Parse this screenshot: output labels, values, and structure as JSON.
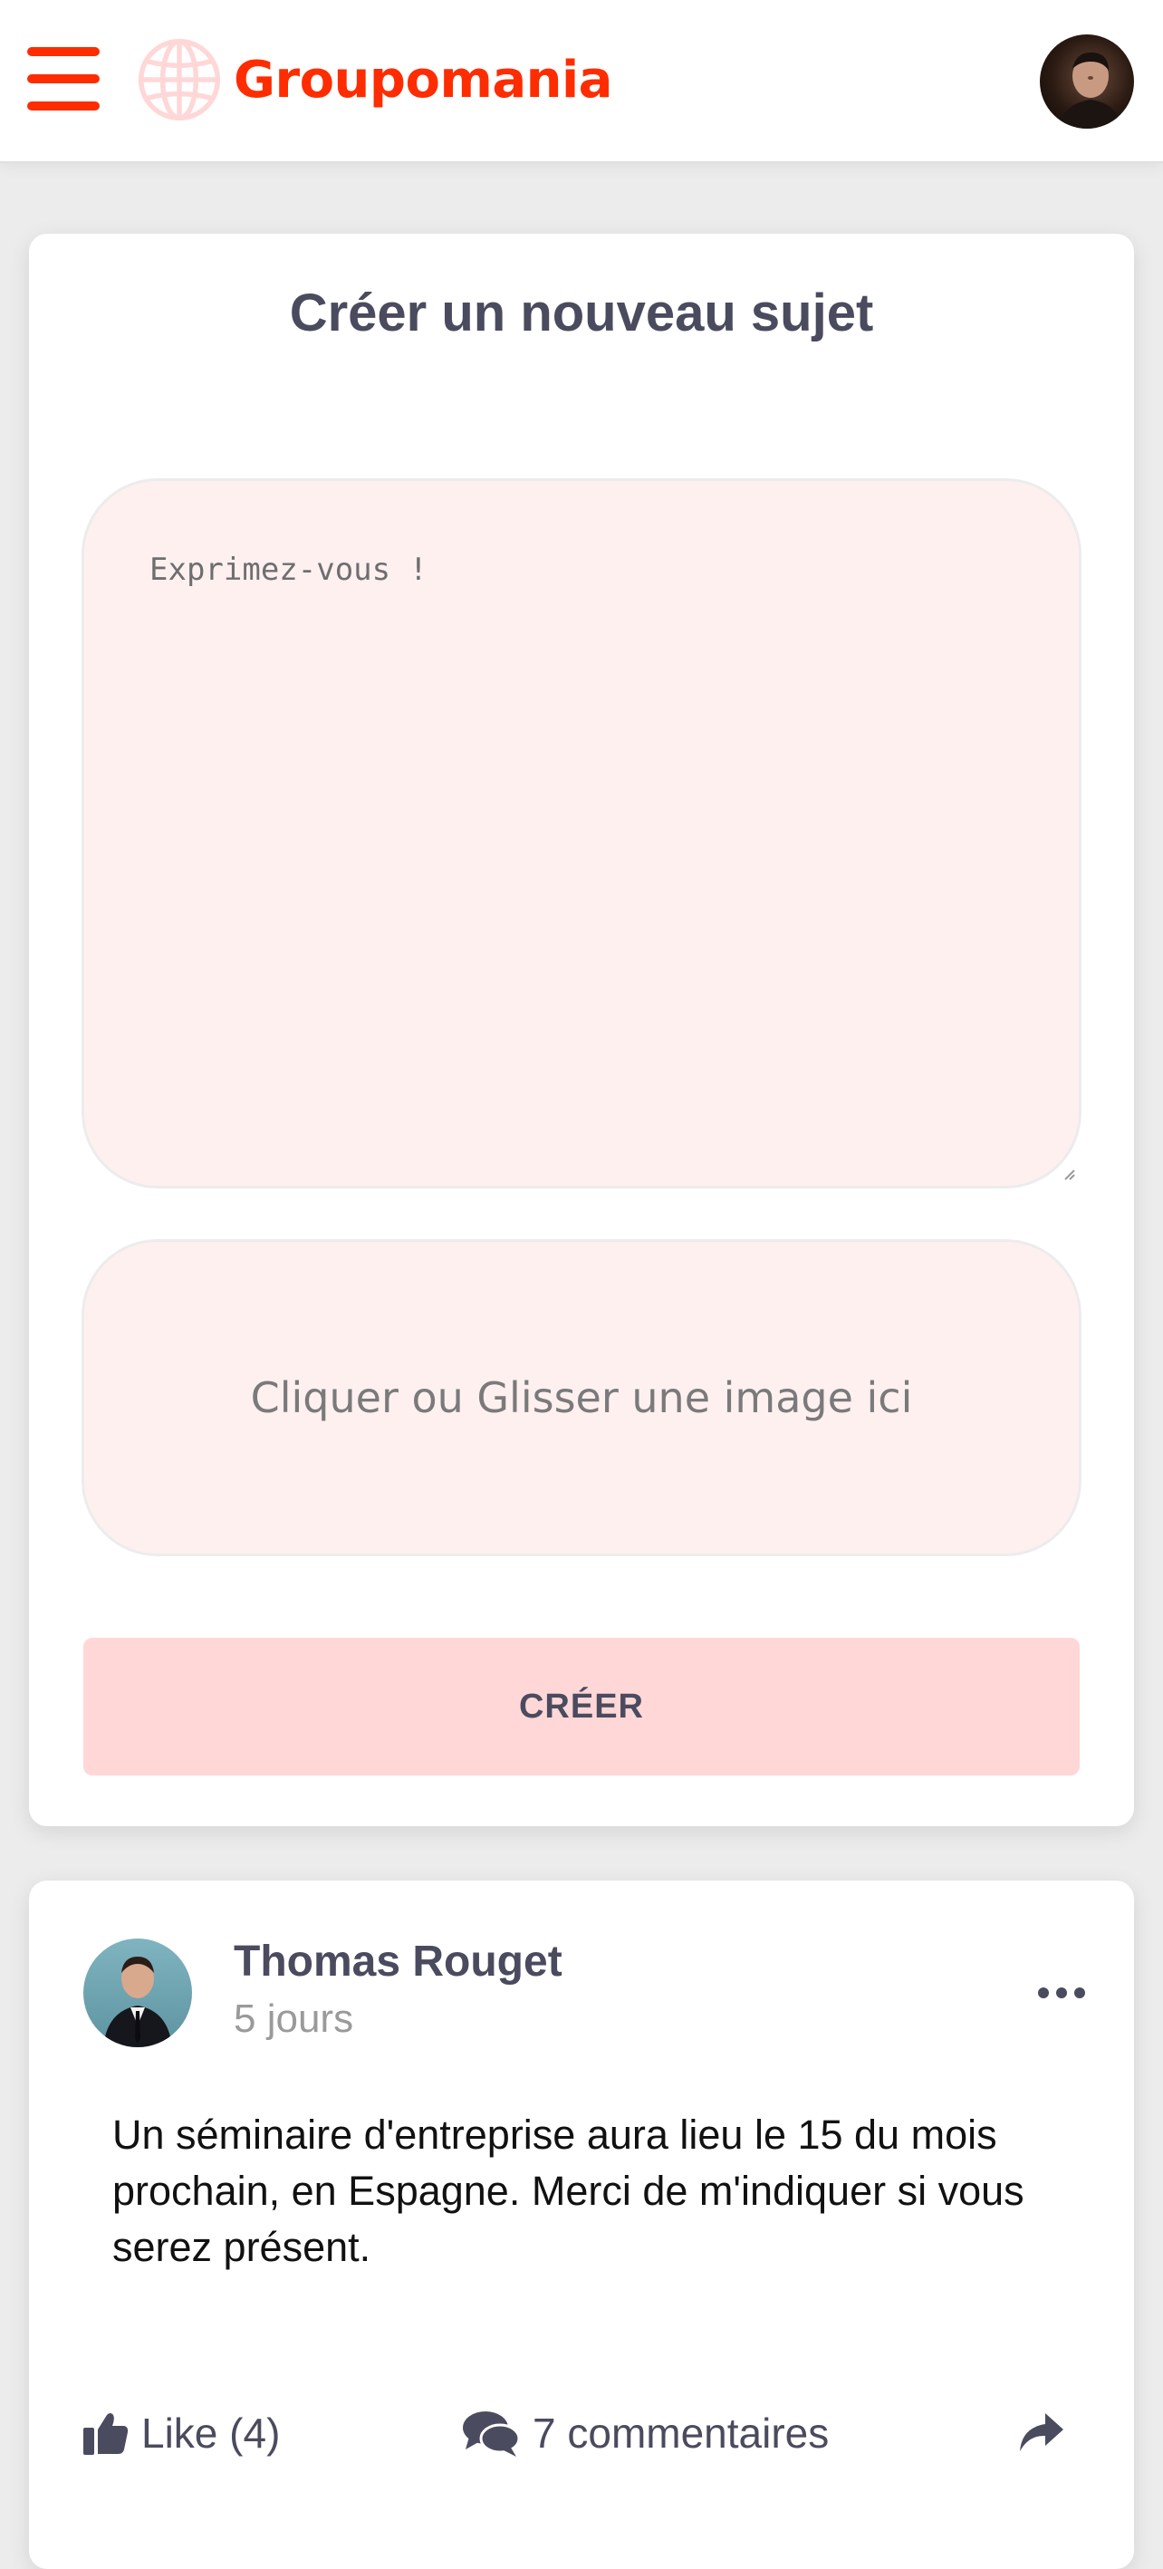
{
  "header": {
    "menu_icon": "hamburger-menu-icon",
    "logo_icon": "globe-icon",
    "brand_name": "Groupomania",
    "user_avatar": "user-avatar",
    "brand_color": "#fd2d01"
  },
  "create_post": {
    "title": "Créer un nouveau sujet",
    "textarea_placeholder": "Exprimez-vous !",
    "image_drop_label": "Cliquer ou Glisser une image ici",
    "submit_label": "CRÉER",
    "field_background": "#fff0f0",
    "button_background": "#ffd7d7"
  },
  "posts": [
    {
      "author": "Thomas Rouget",
      "time_ago": "5 jours",
      "content": "Un séminaire d'entreprise aura lieu le 15 du mois prochain, en Espagne. Merci de m'indiquer si vous serez présent.",
      "more_icon": "ellipsis-icon",
      "like_icon": "thumbs-up-icon",
      "like_label": "Like (4)",
      "comments_icon": "comments-icon",
      "comments_label": "7 commentaires",
      "share_icon": "share-icon"
    }
  ]
}
